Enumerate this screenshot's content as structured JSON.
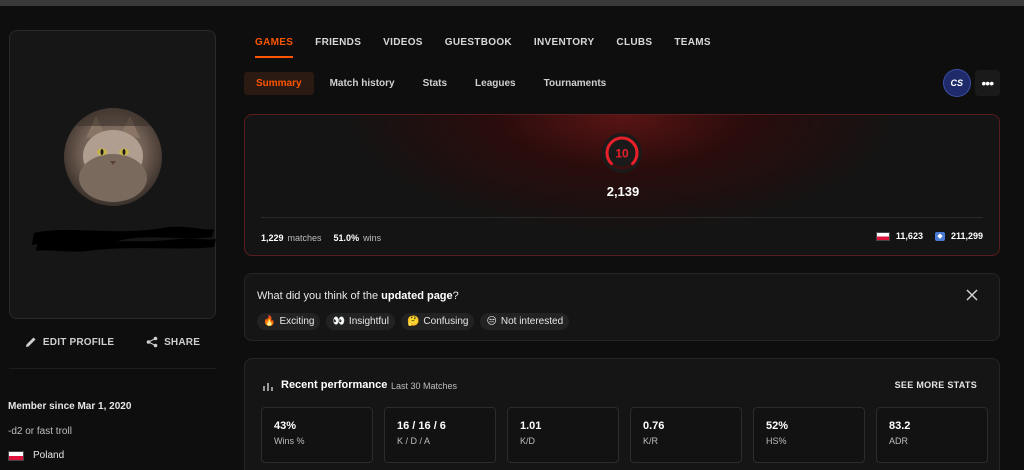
{
  "profile": {
    "actions": {
      "edit": "EDIT PROFILE",
      "share": "SHARE"
    },
    "member_since": "Member since Mar 1, 2020",
    "bio": "-d2 or fast troll",
    "country": "Poland"
  },
  "main_tabs": [
    "GAMES",
    "FRIENDS",
    "VIDEOS",
    "GUESTBOOK",
    "INVENTORY",
    "CLUBS",
    "TEAMS"
  ],
  "sub_tabs": [
    "Summary",
    "Match history",
    "Stats",
    "Leagues",
    "Tournaments"
  ],
  "tools": {
    "game_badge": "CS",
    "more": "•••"
  },
  "elo_card": {
    "level": "10",
    "elo": "2,139",
    "matches_value": "1,229",
    "matches_label": "matches",
    "wins_value": "51.0%",
    "wins_label": "wins",
    "country_rank": "11,623",
    "global_rank": "211,299"
  },
  "feedback": {
    "question_prefix": "What did you think of the ",
    "question_bold": "updated page",
    "question_suffix": "?",
    "options": [
      {
        "emoji": "🔥",
        "label": "Exciting"
      },
      {
        "emoji": "👀",
        "label": "Insightful"
      },
      {
        "emoji": "🤔",
        "label": "Confusing"
      },
      {
        "emoji": "😒",
        "label": "Not interested"
      }
    ]
  },
  "performance": {
    "title": "Recent performance",
    "subtitle": "Last 30 Matches",
    "see_more": "SEE MORE STATS",
    "stats": [
      {
        "value": "43%",
        "label": "Wins %"
      },
      {
        "value": "16 / 16 / 6",
        "label": "K / D / A"
      },
      {
        "value": "1.01",
        "label": "K/D"
      },
      {
        "value": "0.76",
        "label": "K/R"
      },
      {
        "value": "52%",
        "label": "HS%"
      },
      {
        "value": "83.2",
        "label": "ADR"
      }
    ]
  },
  "colors": {
    "accent": "#ff5500",
    "level_red": "#e8202a"
  }
}
